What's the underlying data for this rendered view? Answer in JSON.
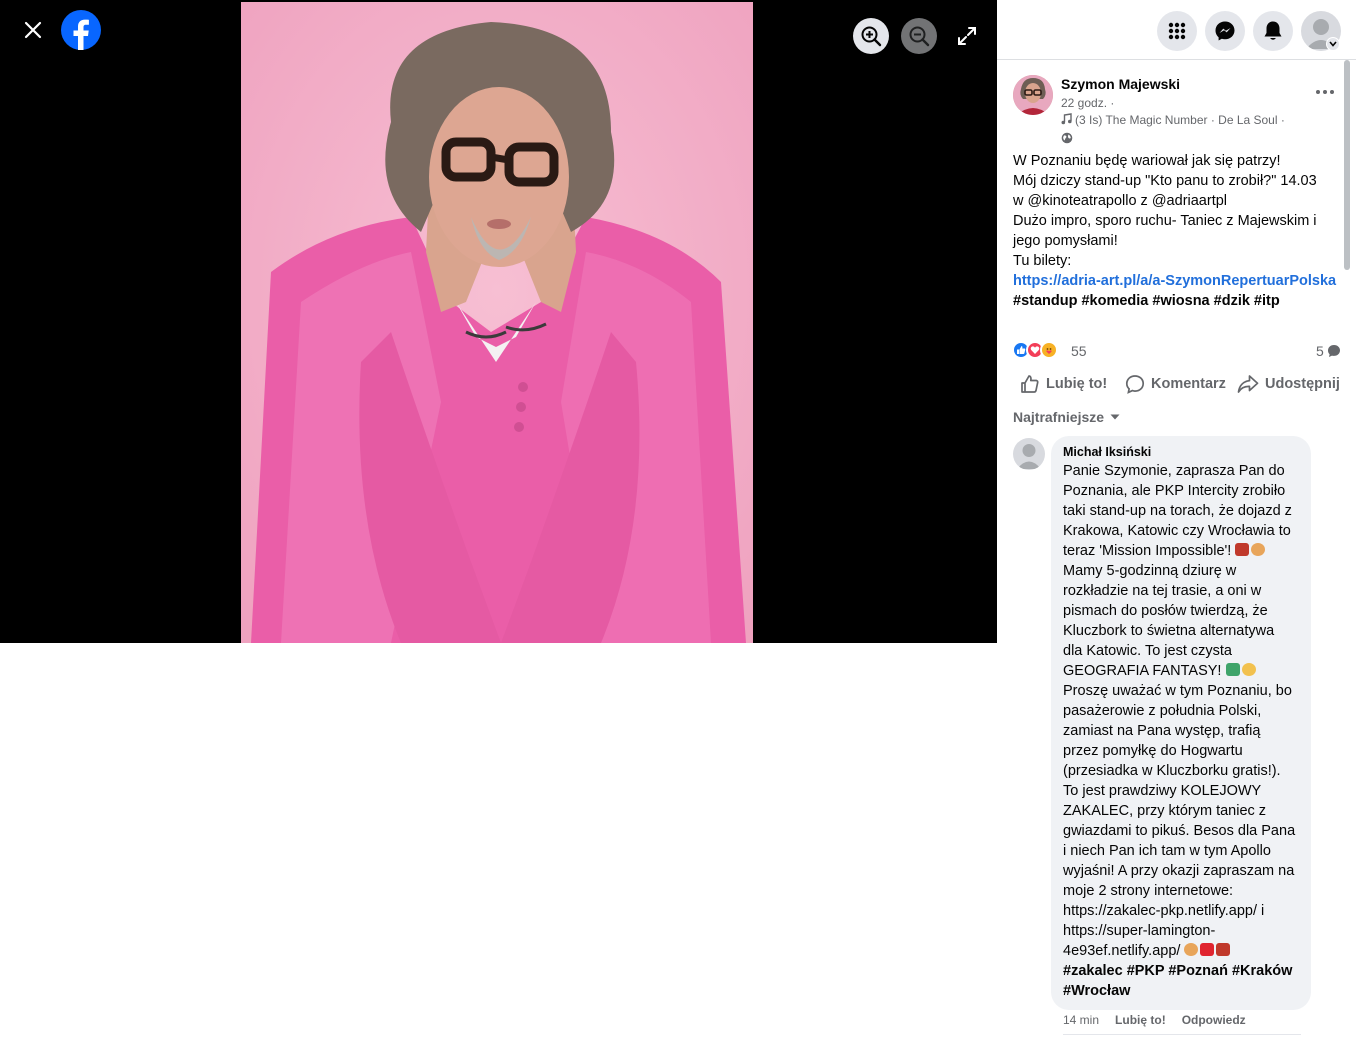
{
  "viewer": {
    "close_icon": "close-icon",
    "logo_icon": "facebook-logo-icon",
    "zoom_in_icon": "zoom-in-icon",
    "zoom_out_icon": "zoom-out-icon",
    "fullscreen_icon": "fullscreen-icon",
    "photo_alt": "photo"
  },
  "topbar": {
    "menu_icon": "grid-menu-icon",
    "messenger_icon": "messenger-icon",
    "notifications_icon": "bell-icon",
    "account_icon": "avatar"
  },
  "post": {
    "author": "Szymon Majewski",
    "time": "22 godz. ·",
    "music": "(3 Is) The Magic Number · De La Soul ·",
    "text_lines": [
      "W Poznaniu będę wariował jak się patrzy!",
      "Mój dziczy stand-up \"Kto panu to zrobił?\" 14.03",
      "w @kinoteatrapollo z @adriaartpl",
      "Dużo impro, sporo ruchu- Taniec z Majewskim i",
      "jego pomysłami!",
      "Tu bilety:"
    ],
    "link": "https://adria-art.pl/a/a-SzymonRepertuarPolska",
    "hashtags": "#standup #komedia #wiosna #dzik #itp",
    "reaction_count": "55",
    "comment_count": "5"
  },
  "actions": {
    "like": "Lubię to!",
    "comment": "Komentarz",
    "share": "Udostępnij"
  },
  "sort": {
    "label": "Najtrafniejsze"
  },
  "comment": {
    "author": "Michał Iksiński",
    "lines": [
      "Panie Szymonie, zaprasza Pan do",
      "Poznania, ale PKP Intercity zrobiło",
      "taki stand-up na torach, że dojazd z",
      "Krakowa, Katowic czy Wrocławia to",
      "teraz 'Mission Impossible'!",
      "Mamy 5-godzinną dziurę w",
      "rozkładzie na tej trasie, a oni w",
      "pismach do posłów twierdzą, że",
      "Kluczbork to świetna alternatywa",
      "dla Katowic. To jest czysta",
      "GEOGRAFIA FANTASY!",
      "Proszę uważać w tym Poznaniu, bo",
      "pasażerowie z południa Polski,",
      "zamiast na Pana występ, trafią",
      "przez pomyłkę do Hogwartu",
      "(przesiadka w Kluczborku gratis!).",
      "To jest prawdziwy KOLEJOWY",
      "ZAKALEC, przy którym taniec z",
      "gwiazdami to pikuś. Besos dla Pana",
      "i niech Pan ich tam w tym Apollo",
      "wyjaśni! A przy okazji zapraszam na",
      "moje 2 strony internetowe:",
      "https://zakalec-pkp.netlify.app/ i",
      "https://super-lamington-",
      "4e93ef.netlify.app/"
    ],
    "hashtags_line1": "#zakalec #PKP #Poznań #Kraków",
    "hashtags_line2": "#Wrocław",
    "time": "14 min",
    "like": "Lubię to!",
    "reply": "Odpowiedz"
  }
}
